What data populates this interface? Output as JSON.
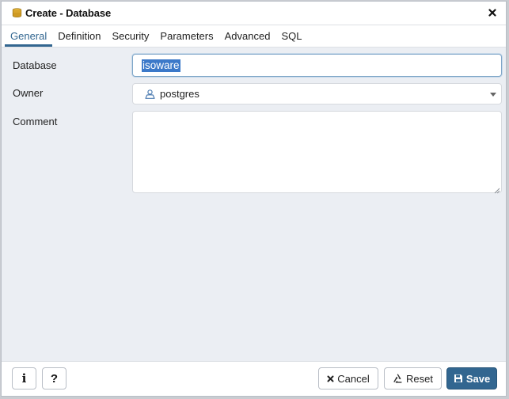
{
  "dialog": {
    "title": "Create - Database",
    "title_icon": "database-icon",
    "close_icon": "close-icon"
  },
  "tabs": [
    {
      "label": "General",
      "active": true
    },
    {
      "label": "Definition",
      "active": false
    },
    {
      "label": "Security",
      "active": false
    },
    {
      "label": "Parameters",
      "active": false
    },
    {
      "label": "Advanced",
      "active": false
    },
    {
      "label": "SQL",
      "active": false
    }
  ],
  "form": {
    "database_label": "Database",
    "database_value": "isoware",
    "owner_label": "Owner",
    "owner_value": "postgres",
    "owner_icon": "user-icon",
    "comment_label": "Comment",
    "comment_value": ""
  },
  "footer": {
    "info_label": "i",
    "help_label": "?",
    "cancel_label": "Cancel",
    "reset_label": "Reset",
    "save_label": "Save"
  },
  "colors": {
    "accent": "#326690",
    "selection": "#3c79c9",
    "background": "#ebeef3"
  }
}
